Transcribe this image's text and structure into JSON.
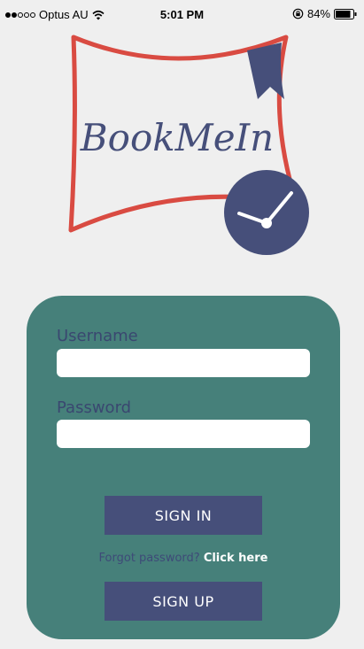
{
  "status_bar": {
    "carrier": "Optus AU",
    "time": "5:01 PM",
    "battery": "84%",
    "signal_bars_filled": 2,
    "signal_bars_total": 5
  },
  "logo": {
    "text": "BookMeIn",
    "colors": {
      "frame": "#d94b42",
      "accent": "#464f7a"
    }
  },
  "login": {
    "username_label": "Username",
    "username_value": "",
    "password_label": "Password",
    "password_value": "",
    "sign_in_label": "SIGN IN",
    "forgot_text": "Forgot password?",
    "click_here_label": "Click here",
    "sign_up_label": "SIGN UP"
  },
  "colors": {
    "background": "#efefef",
    "card": "#46807a",
    "button": "#464f7a",
    "label": "#3a4770"
  },
  "icons": [
    "wifi-icon",
    "rotation-lock-icon",
    "battery-icon",
    "bookmark-icon",
    "clock-icon"
  ]
}
